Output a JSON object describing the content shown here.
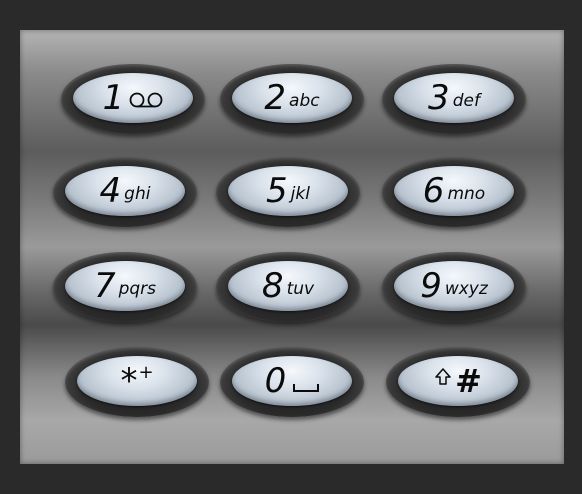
{
  "keypad": {
    "keys": [
      {
        "digit": "1",
        "letters": "",
        "icon": "voicemail-icon"
      },
      {
        "digit": "2",
        "letters": "abc"
      },
      {
        "digit": "3",
        "letters": "def"
      },
      {
        "digit": "4",
        "letters": "ghi"
      },
      {
        "digit": "5",
        "letters": "jkl"
      },
      {
        "digit": "6",
        "letters": "mno"
      },
      {
        "digit": "7",
        "letters": "pqrs"
      },
      {
        "digit": "8",
        "letters": "tuv"
      },
      {
        "digit": "9",
        "letters": "wxyz"
      },
      {
        "digit": "*",
        "letters": "+"
      },
      {
        "digit": "0",
        "letters": "",
        "icon": "space-icon"
      },
      {
        "digit": "#",
        "letters": "",
        "icon": "shift-arrow-icon"
      }
    ]
  },
  "colors": {
    "background": "#2a2a2a",
    "key_cap": "#d9e1ea",
    "key_bezel": "#1b1b1b",
    "text": "#0b0b0b"
  }
}
